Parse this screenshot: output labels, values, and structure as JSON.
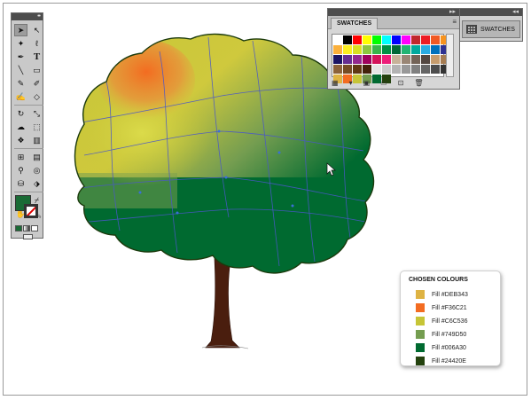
{
  "swatches_panel": {
    "tab_label": "SWATCHES",
    "grid_colors": [
      "#ffffff",
      "#000000",
      "#ff0000",
      "#ffff00",
      "#00ff00",
      "#00ffff",
      "#0000ff",
      "#ff00ff",
      "#c1272d",
      "#ed1c24",
      "#f15a24",
      "#f7931e",
      "#fbb03b",
      "#fcee21",
      "#d9e021",
      "#8cc63f",
      "#39b54a",
      "#009245",
      "#006837",
      "#22b573",
      "#00a99d",
      "#29abe2",
      "#0071bc",
      "#2e3192",
      "#1b1464",
      "#662d91",
      "#93278f",
      "#9e005d",
      "#d4145a",
      "#ed1e79",
      "#c7b299",
      "#998675",
      "#736357",
      "#534741",
      "#c69c6d",
      "#a67c52",
      "#8c6239",
      "#754c24",
      "#603813",
      "#42210b",
      "#e6e6e6",
      "#cccccc",
      "#b3b3b3",
      "#999999",
      "#808080",
      "#666666",
      "#4d4d4d",
      "#333333",
      "#deb343",
      "#f36c21",
      "#c6c536",
      "#749d50",
      "#006a30",
      "#24420e"
    ]
  },
  "swatch_dock": {
    "label": "SWATCHES"
  },
  "chosen_colours": {
    "title": "CHOSEN COLOURS",
    "items": [
      {
        "label": "Fill  #DEB343",
        "color": "#DEB343"
      },
      {
        "label": "Fill  #F36C21",
        "color": "#F36C21"
      },
      {
        "label": "Fill  #C6C536",
        "color": "#C6C536"
      },
      {
        "label": "Fill  #749D50",
        "color": "#749D50"
      },
      {
        "label": "Fill  #006A30",
        "color": "#006A30"
      },
      {
        "label": "Fill  #24420E",
        "color": "#24420E"
      }
    ]
  },
  "tools_panel": {
    "fill_color": "#1a6b35",
    "tools": [
      "selection-tool",
      "direct-selection-tool",
      "magic-wand-tool",
      "lasso-tool",
      "pen-tool",
      "type-tool",
      "line-tool",
      "rectangle-tool",
      "paintbrush-tool",
      "pencil-tool",
      "blob-brush-tool",
      "eraser-tool",
      "rotate-tool",
      "scale-tool",
      "warp-tool",
      "free-transform-tool",
      "symbol-sprayer-tool",
      "graph-tool",
      "mesh-tool",
      "gradient-tool",
      "eyedropper-tool",
      "blend-tool",
      "live-paint-tool",
      "live-paint-selection-tool",
      "artboard-tool",
      "slice-tool",
      "hand-tool",
      "zoom-tool"
    ]
  }
}
